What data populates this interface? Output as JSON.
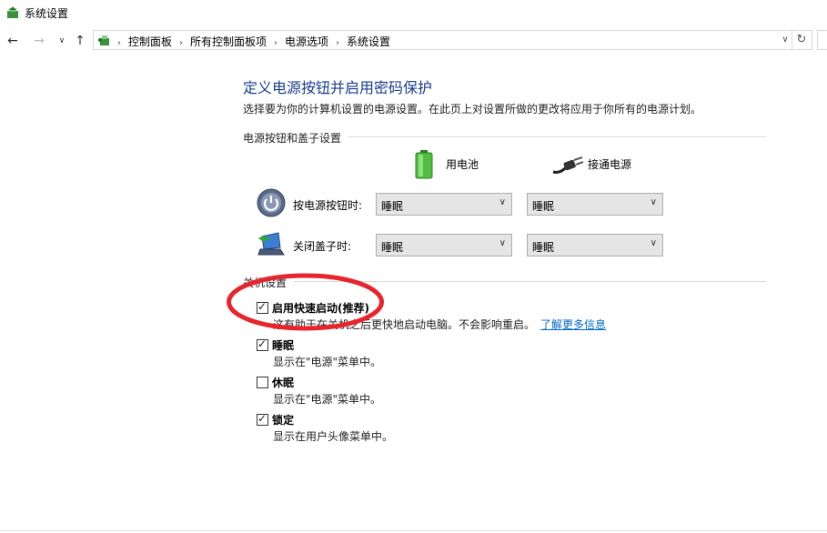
{
  "window": {
    "title": "系统设置",
    "icon": "power-options-icon"
  },
  "nav": {
    "back_icon": "arrow-left-icon",
    "forward_icon": "arrow-right-icon",
    "recent_icon": "chevron-down-icon",
    "up_icon": "arrow-up-icon",
    "breadcrumbs": [
      "控制面板",
      "所有控制面板项",
      "电源选项",
      "系统设置"
    ],
    "refresh_icon": "refresh-icon"
  },
  "page": {
    "title": "定义电源按钮并启用密码保护",
    "description": "选择要为你的计算机设置的电源设置。在此页上对设置所做的更改将应用于你所有的电源计划。"
  },
  "power_section": {
    "heading": "电源按钮和盖子设置",
    "columns": {
      "battery": "用电池",
      "plugged": "接通电源"
    },
    "rows": [
      {
        "label": "按电源按钮时:",
        "battery_value": "睡眠",
        "plugged_value": "睡眠",
        "icon": "power-button-icon"
      },
      {
        "label": "关闭盖子时:",
        "battery_value": "睡眠",
        "plugged_value": "睡眠",
        "icon": "laptop-lid-icon"
      }
    ]
  },
  "shutdown_section": {
    "heading": "关机设置",
    "options": [
      {
        "label": "启用快速启动(推荐)",
        "checked": true,
        "desc": "这有助于在关机之后更快地启动电脑。不会影响重启。",
        "link": "了解更多信息"
      },
      {
        "label": "睡眠",
        "checked": true,
        "desc": "显示在\"电源\"菜单中。"
      },
      {
        "label": "休眠",
        "checked": false,
        "desc": "显示在\"电源\"菜单中。"
      },
      {
        "label": "锁定",
        "checked": true,
        "desc": "显示在用户头像菜单中。"
      }
    ]
  },
  "annotation": {
    "color": "#e8242c"
  },
  "colors": {
    "title_blue": "#1a3d8f",
    "link_blue": "#0066cc"
  }
}
